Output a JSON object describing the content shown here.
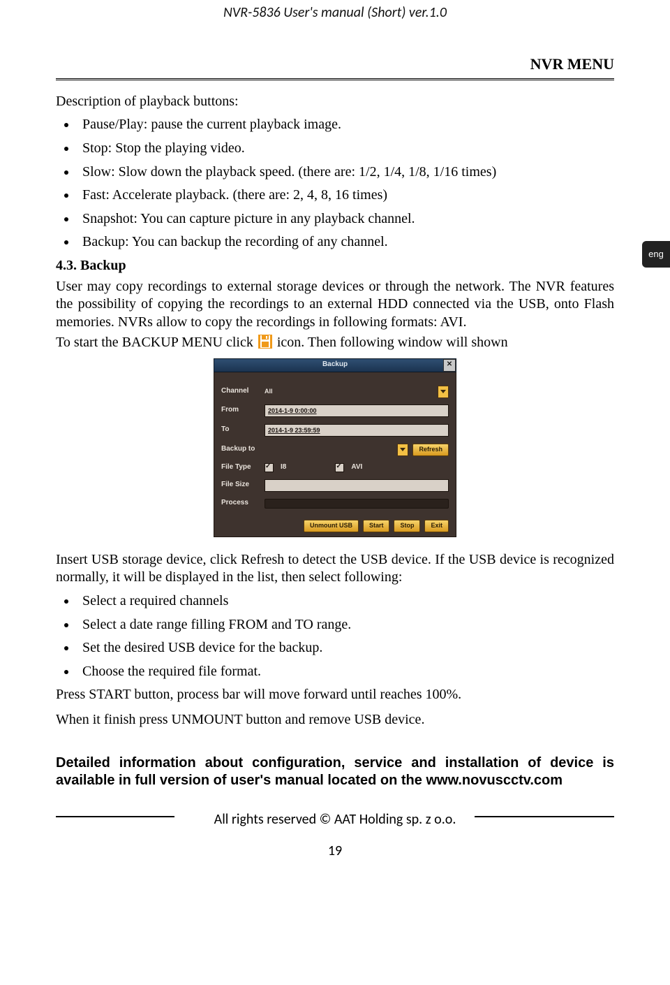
{
  "header": {
    "title": "NVR-5836 User's manual (Short) ver.1.0"
  },
  "lang_tab": "eng",
  "section_title": "NVR MENU",
  "intro_line": "Description of playback buttons:",
  "bullets1": [
    "Pause/Play: pause the current playback image.",
    "Stop: Stop the playing video.",
    "Slow: Slow down the playback speed. (there are: 1/2, 1/4, 1/8, 1/16 times)",
    "Fast: Accelerate playback. (there are: 2, 4, 8, 16 times)",
    "Snapshot: You can capture picture in any playback channel.",
    "Backup: You can backup the recording of any channel."
  ],
  "subheading": {
    "num": "4.3.",
    "text": "Backup"
  },
  "paragraph1": "User may copy recordings to external storage devices or through the network. The NVR features the possibility of copying the recordings to an external HDD connected via the USB, onto Flash memories. NVRs allow to copy the recordings in following formats: AVI.",
  "icon_line": {
    "pre": "To start the BACKUP MENU click",
    "post": "icon. Then following window will shown"
  },
  "dialog": {
    "title": "Backup",
    "close": "✕",
    "labels": {
      "channel": "Channel",
      "from": "From",
      "to": "To",
      "backup_to": "Backup to",
      "file_type": "File Type",
      "file_size": "File Size",
      "process": "Process"
    },
    "values": {
      "channel": "All",
      "from": "2014-1-9 0:00:00",
      "to": "2014-1-9 23:59:59",
      "ft_i8": "I8",
      "ft_avi": "AVI"
    },
    "buttons": {
      "refresh": "Refresh",
      "unmount": "Unmount USB",
      "start": "Start",
      "stop": "Stop",
      "exit": "Exit"
    }
  },
  "paragraph2": "Insert USB storage device, click Refresh to detect the USB device. If the USB device is recognized normally, it will be displayed in the list, then select following:",
  "bullets2": [
    "Select a required channels",
    "Select a date range filling FROM and TO range.",
    "Set the desired USB device for the backup.",
    "Choose the required file format."
  ],
  "paragraph3": "Press START button, process bar will move forward until reaches 100%.",
  "paragraph4": "When it finish press UNMOUNT button and remove USB device.",
  "notice": "Detailed information about configuration, service and installation of device is available in full version of user's manual located on the www.novuscctv.com",
  "footer": {
    "rights": "All rights reserved © AAT Holding sp. z o.o.",
    "page_num": "19"
  }
}
